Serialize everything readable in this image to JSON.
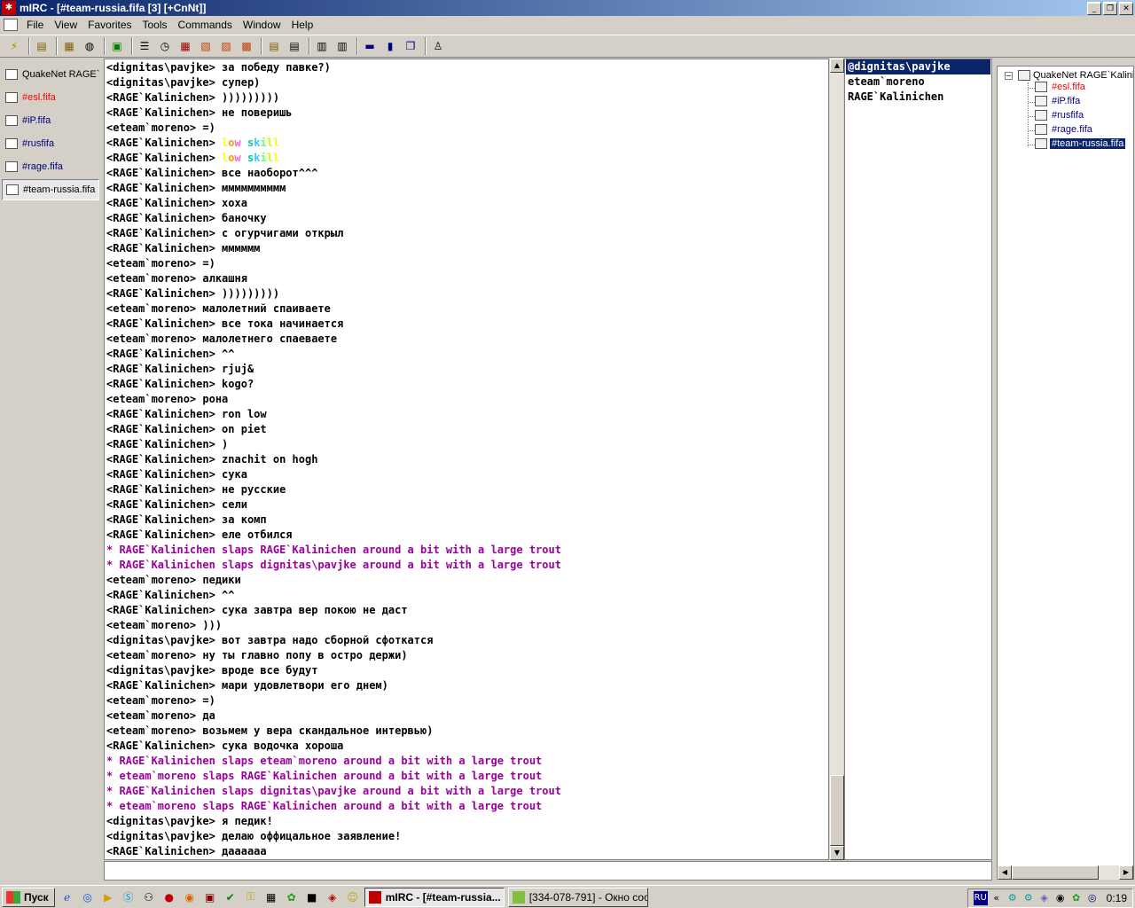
{
  "window": {
    "title": "mIRC - [#team-russia.fifa [3] [+CnNt]]"
  },
  "menu": [
    "File",
    "View",
    "Favorites",
    "Tools",
    "Commands",
    "Window",
    "Help"
  ],
  "switchbar": {
    "items": [
      {
        "label": "QuakeNet RAGE`...",
        "color": "#000000"
      },
      {
        "label": "#esl.fifa",
        "color": "#ff0000"
      },
      {
        "label": "#iP.fifa",
        "color": "#000080"
      },
      {
        "label": "#rusfifa",
        "color": "#000080"
      },
      {
        "label": "#rage.fifa",
        "color": "#000080"
      },
      {
        "label": "#team-russia.fifa",
        "color": "#000000"
      }
    ]
  },
  "chat": {
    "lines": [
      {
        "text": "<dignitas\\pavjke> за победу павке?)",
        "type": "msg"
      },
      {
        "text": "<dignitas\\pavjke> супер)",
        "type": "msg"
      },
      {
        "text": "<RAGE`Kalinichen> )))))))))",
        "type": "msg"
      },
      {
        "text": "<RAGE`Kalinichen> не поверишь",
        "type": "msg"
      },
      {
        "text": "<eteam`moreno> =)",
        "type": "msg"
      },
      {
        "text": "<RAGE`Kalinichen> low skill",
        "type": "rainbow"
      },
      {
        "text": "<RAGE`Kalinichen> low skill",
        "type": "rainbow"
      },
      {
        "text": "<RAGE`Kalinichen> все наоборот^^^",
        "type": "msg"
      },
      {
        "text": "<RAGE`Kalinichen> мммммммммм",
        "type": "msg"
      },
      {
        "text": "<RAGE`Kalinichen> хоха",
        "type": "msg"
      },
      {
        "text": "<RAGE`Kalinichen> баночку",
        "type": "msg"
      },
      {
        "text": "<RAGE`Kalinichen> с огурчигами открыл",
        "type": "msg"
      },
      {
        "text": "<RAGE`Kalinichen> мммммм",
        "type": "msg"
      },
      {
        "text": "<eteam`moreno> =)",
        "type": "msg"
      },
      {
        "text": "<eteam`moreno> алкашня",
        "type": "msg"
      },
      {
        "text": "<RAGE`Kalinichen> )))))))))",
        "type": "msg"
      },
      {
        "text": "<eteam`moreno> малолетний спаиваете",
        "type": "msg"
      },
      {
        "text": "<RAGE`Kalinichen> все тока начинается",
        "type": "msg"
      },
      {
        "text": "<eteam`moreno> малолетнего спаеваете",
        "type": "msg"
      },
      {
        "text": "<RAGE`Kalinichen> ^^",
        "type": "msg"
      },
      {
        "text": "<RAGE`Kalinichen> rjuj&",
        "type": "msg"
      },
      {
        "text": "<RAGE`Kalinichen> kogo?",
        "type": "msg"
      },
      {
        "text": "<eteam`moreno> рона",
        "type": "msg"
      },
      {
        "text": "<RAGE`Kalinichen> ron low",
        "type": "msg"
      },
      {
        "text": "<RAGE`Kalinichen> on piet",
        "type": "msg"
      },
      {
        "text": "<RAGE`Kalinichen> )",
        "type": "msg"
      },
      {
        "text": "<RAGE`Kalinichen> znachit on hogh",
        "type": "msg"
      },
      {
        "text": "<RAGE`Kalinichen> сука",
        "type": "msg"
      },
      {
        "text": "<RAGE`Kalinichen> не русские",
        "type": "msg"
      },
      {
        "text": "<RAGE`Kalinichen> сели",
        "type": "msg"
      },
      {
        "text": "<RAGE`Kalinichen> за комп",
        "type": "msg"
      },
      {
        "text": "<RAGE`Kalinichen> еле отбился",
        "type": "msg"
      },
      {
        "text": "* RAGE`Kalinichen slaps RAGE`Kalinichen around a bit with a large trout",
        "type": "action"
      },
      {
        "text": "* RAGE`Kalinichen slaps dignitas\\pavjke around a bit with a large trout",
        "type": "action"
      },
      {
        "text": "<eteam`moreno> педики",
        "type": "msg"
      },
      {
        "text": "<RAGE`Kalinichen> ^^",
        "type": "msg"
      },
      {
        "text": "<RAGE`Kalinichen> сука завтра вер покою не даст",
        "type": "msg"
      },
      {
        "text": "<eteam`moreno> )))",
        "type": "msg"
      },
      {
        "text": "<dignitas\\pavjke> вот завтра надо сборной сфоткатся",
        "type": "msg"
      },
      {
        "text": "<eteam`moreno> ну ты главно попу в остро держи)",
        "type": "msg"
      },
      {
        "text": "<dignitas\\pavjke> вроде все будут",
        "type": "msg"
      },
      {
        "text": "<RAGE`Kalinichen> мари удовлетвори его днем)",
        "type": "msg"
      },
      {
        "text": "<eteam`moreno> =)",
        "type": "msg"
      },
      {
        "text": "<eteam`moreno> да",
        "type": "msg"
      },
      {
        "text": "<eteam`moreno> возьмем у вера скандальное интервью)",
        "type": "msg"
      },
      {
        "text": "<RAGE`Kalinichen> сука водочка хороша",
        "type": "msg"
      },
      {
        "text": "* RAGE`Kalinichen slaps eteam`moreno around a bit with a large trout",
        "type": "action"
      },
      {
        "text": "* eteam`moreno slaps RAGE`Kalinichen around a bit with a large trout",
        "type": "action"
      },
      {
        "text": "* RAGE`Kalinichen slaps dignitas\\pavjke around a bit with a large trout",
        "type": "action"
      },
      {
        "text": "* eteam`moreno slaps RAGE`Kalinichen around a bit with a large trout",
        "type": "action"
      },
      {
        "text": "<dignitas\\pavjke> я педик!",
        "type": "msg"
      },
      {
        "text": "<dignitas\\pavjke> делаю оффицальное заявление!",
        "type": "msg"
      },
      {
        "text": "<RAGE`Kalinichen> даааааа",
        "type": "msg"
      }
    ]
  },
  "nicklist": [
    "@dignitas\\pavjke",
    "eteam`moreno",
    "RAGE`Kalinichen"
  ],
  "tree": {
    "root": "QuakeNet RAGE`Kalini",
    "children": [
      {
        "label": "#esl.fifa",
        "color": "#ff0000"
      },
      {
        "label": "#iP.fifa",
        "color": "#000080"
      },
      {
        "label": "#rusfifa",
        "color": "#000080"
      },
      {
        "label": "#rage.fifa",
        "color": "#000080"
      },
      {
        "label": "#team-russia.fifa",
        "color": "#000080"
      }
    ]
  },
  "taskbar": {
    "start": "Пуск",
    "tasks": [
      "mIRC - [#team-russia...",
      "[334-078-791] - Окно соо..."
    ],
    "tray_lang": "RU",
    "clock": "0:19"
  },
  "colors": {
    "action": "#9c009c",
    "selection": "#0a246a",
    "rainbow": [
      "#ffff00",
      "#ff9900",
      "#ff66cc",
      "#00cc99",
      "#33ccff",
      "#66ff66",
      "#ccff00"
    ]
  }
}
